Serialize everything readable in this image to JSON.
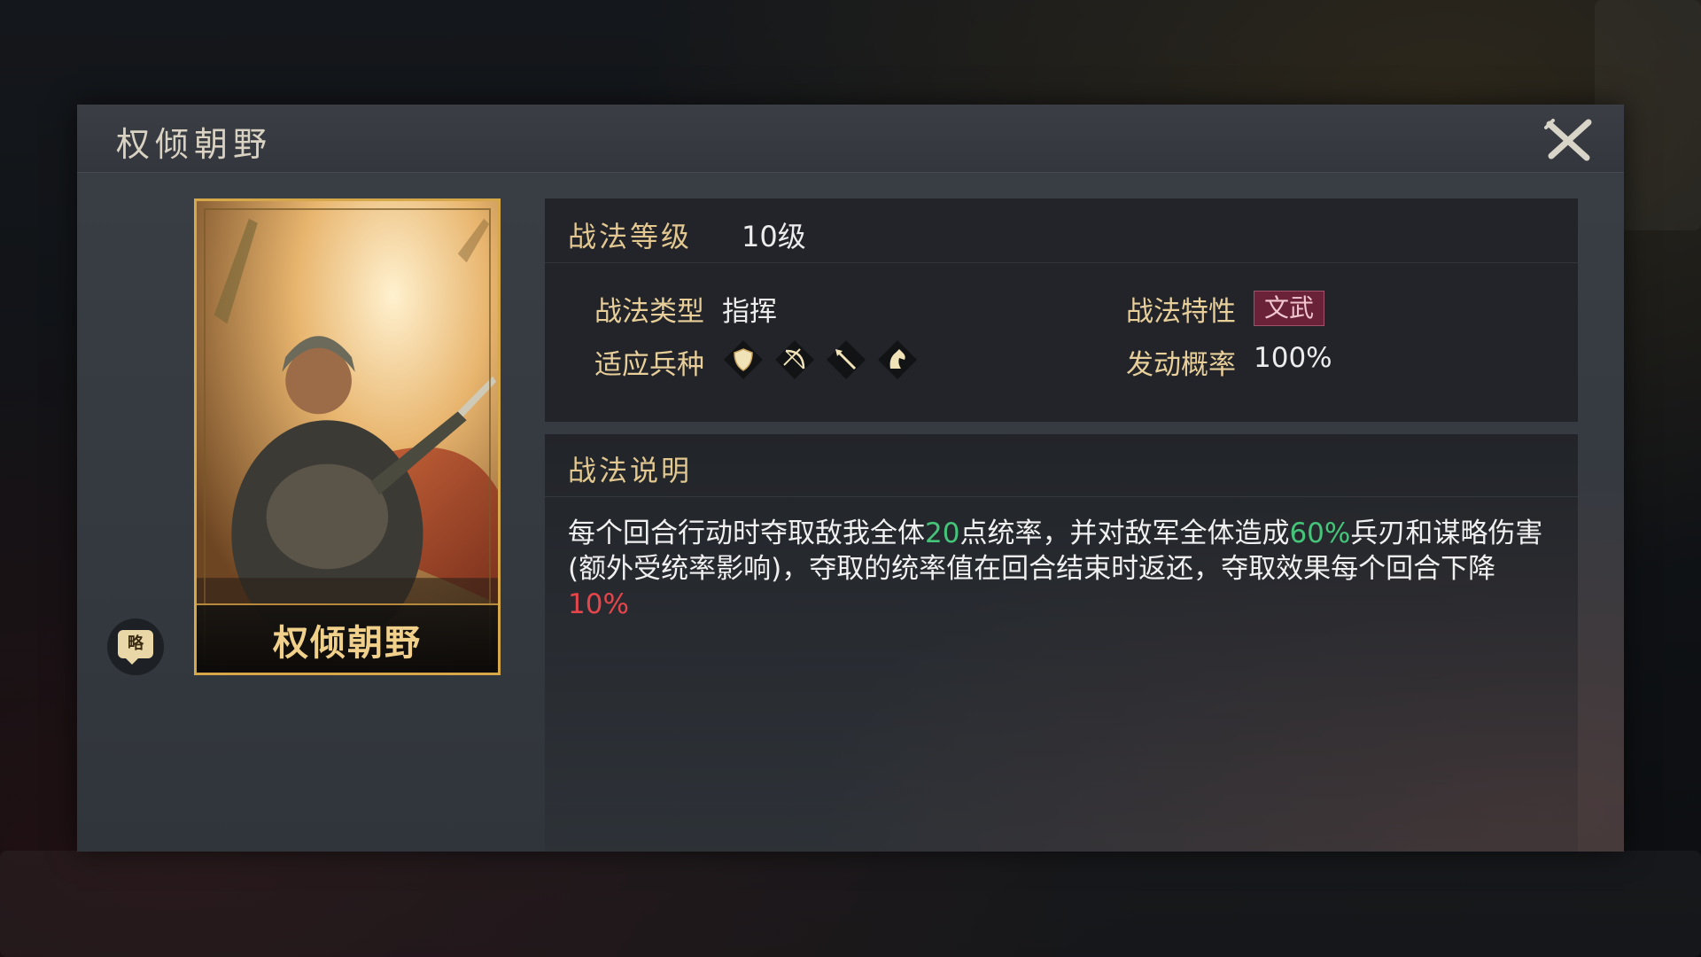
{
  "dialog": {
    "title": "权倾朝野"
  },
  "card": {
    "name": "权倾朝野"
  },
  "brief_button": {
    "label": "略"
  },
  "info": {
    "level_label": "战法等级",
    "level_value": "10级",
    "type_label": "战法类型",
    "type_value": "指挥",
    "trait_label": "战法特性",
    "trait_value": "文武",
    "units_label": "适应兵种",
    "unit_icons": [
      "shield-icon",
      "bow-icon",
      "spear-icon",
      "horse-icon"
    ],
    "rate_label": "发动概率",
    "rate_value": "100%"
  },
  "description": {
    "title": "战法说明",
    "part1": "每个回合行动时夺取敌我全体",
    "value1": "20",
    "part2": "点统率，并对敌军全体造成",
    "value2": "60%",
    "part3": "兵刃和谋略伤害(额外受统率影响)，夺取的统率值在回合结束时返还，夺取效果每个回合下降",
    "value3": "10%"
  },
  "colors": {
    "gold": "#e2c890",
    "highlight_green": "#45c57a",
    "highlight_red": "#e5464b",
    "trait_badge": "#6a2238",
    "card_border": "#d6a84a"
  }
}
